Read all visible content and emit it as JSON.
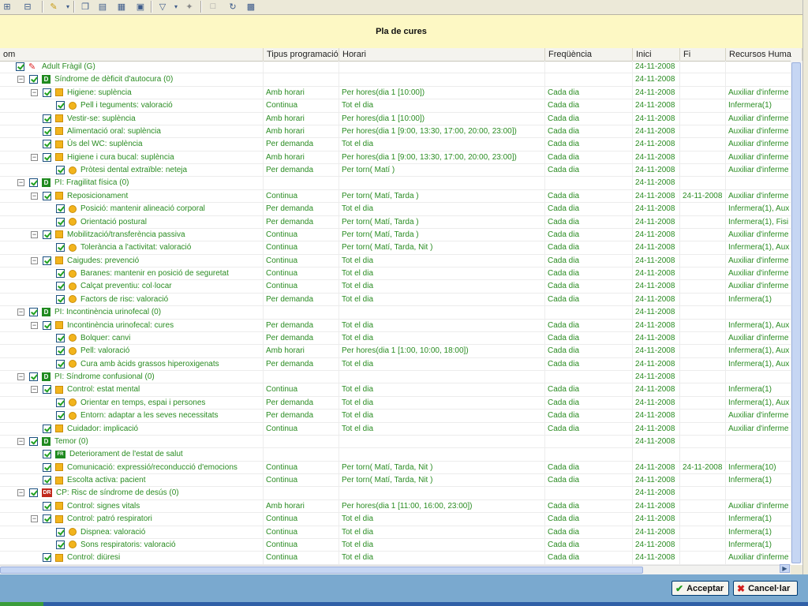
{
  "toolbar": {
    "icons": [
      "tree-expand-icon",
      "tree-collapse-icon",
      "pencil-icon",
      "copy-icon",
      "clipboard-icon",
      "book-icon",
      "monitor-icon",
      "filter-icon",
      "pin-icon",
      "document-icon",
      "refresh-icon",
      "window-icon"
    ]
  },
  "panel": {
    "title": "Pla de cures"
  },
  "columns": [
    "om",
    "Tipus programació",
    "Horari",
    "Freqüència",
    "Inici",
    "Fi",
    "Recursos Huma"
  ],
  "rows": [
    {
      "level": 0,
      "exp": false,
      "icon": "pencil",
      "name": "Adult Fràgil (G)",
      "tipus": "",
      "horari": "",
      "freq": "",
      "inici": "24-11-2008",
      "fi": "",
      "recursos": ""
    },
    {
      "level": 1,
      "exp": true,
      "icon": "D",
      "name": "Síndrome de dèficit d'autocura (0)",
      "tipus": "",
      "horari": "",
      "freq": "",
      "inici": "24-11-2008",
      "fi": "",
      "recursos": ""
    },
    {
      "level": 2,
      "exp": true,
      "icon": "sq",
      "name": "Higiene: suplència",
      "tipus": "Amb horari",
      "horari": "Per hores(dia 1 [10:00])",
      "freq": "Cada dia",
      "inici": "24-11-2008",
      "fi": "",
      "recursos": "Auxiliar d'inferme"
    },
    {
      "level": 3,
      "exp": false,
      "icon": "dot",
      "name": "Pell i teguments: valoració",
      "tipus": "Continua",
      "horari": "Tot el dia",
      "freq": "Cada dia",
      "inici": "24-11-2008",
      "fi": "",
      "recursos": "Infermera(1)"
    },
    {
      "level": 2,
      "exp": false,
      "icon": "sq",
      "name": "Vestir-se: suplència",
      "tipus": "Amb horari",
      "horari": "Per hores(dia 1 [10:00])",
      "freq": "Cada dia",
      "inici": "24-11-2008",
      "fi": "",
      "recursos": "Auxiliar d'inferme"
    },
    {
      "level": 2,
      "exp": false,
      "icon": "sq",
      "name": "Alimentació oral: suplència",
      "tipus": "Amb horari",
      "horari": "Per hores(dia 1 [9:00, 13:30, 17:00, 20:00, 23:00])",
      "freq": "Cada dia",
      "inici": "24-11-2008",
      "fi": "",
      "recursos": "Auxiliar d'inferme"
    },
    {
      "level": 2,
      "exp": false,
      "icon": "sq",
      "name": "Ús del WC: suplència",
      "tipus": "Per demanda",
      "horari": "Tot el dia",
      "freq": "Cada dia",
      "inici": "24-11-2008",
      "fi": "",
      "recursos": "Auxiliar d'inferme"
    },
    {
      "level": 2,
      "exp": true,
      "icon": "sq",
      "name": "Higiene i cura bucal: suplència",
      "tipus": "Amb horari",
      "horari": "Per hores(dia 1 [9:00, 13:30, 17:00, 20:00, 23:00])",
      "freq": "Cada dia",
      "inici": "24-11-2008",
      "fi": "",
      "recursos": "Auxiliar d'inferme"
    },
    {
      "level": 3,
      "exp": false,
      "icon": "dot",
      "name": "Pròtesi dental extraïble: neteja",
      "tipus": "Per demanda",
      "horari": "Per torn( Matí )",
      "freq": "Cada dia",
      "inici": "24-11-2008",
      "fi": "",
      "recursos": "Auxiliar d'inferme"
    },
    {
      "level": 1,
      "exp": true,
      "icon": "D",
      "name": "PI: Fragilitat física (0)",
      "tipus": "",
      "horari": "",
      "freq": "",
      "inici": "24-11-2008",
      "fi": "",
      "recursos": ""
    },
    {
      "level": 2,
      "exp": true,
      "icon": "sq",
      "name": "Reposicionament",
      "tipus": "Continua",
      "horari": "Per torn( Matí, Tarda )",
      "freq": "Cada dia",
      "inici": "24-11-2008",
      "fi": "24-11-2008",
      "recursos": "Auxiliar d'inferme"
    },
    {
      "level": 3,
      "exp": false,
      "icon": "dot",
      "name": "Posició: mantenir alineació corporal",
      "tipus": "Per demanda",
      "horari": "Tot el dia",
      "freq": "Cada dia",
      "inici": "24-11-2008",
      "fi": "",
      "recursos": "Infermera(1), Aux"
    },
    {
      "level": 3,
      "exp": false,
      "icon": "dot",
      "name": "Orientació postural",
      "tipus": "Per demanda",
      "horari": "Per torn( Matí, Tarda )",
      "freq": "Cada dia",
      "inici": "24-11-2008",
      "fi": "",
      "recursos": "Infermera(1), Fisi"
    },
    {
      "level": 2,
      "exp": true,
      "icon": "sq",
      "name": "Mobilització/transferència passiva",
      "tipus": "Continua",
      "horari": "Per torn( Matí, Tarda )",
      "freq": "Cada dia",
      "inici": "24-11-2008",
      "fi": "",
      "recursos": "Auxiliar d'inferme"
    },
    {
      "level": 3,
      "exp": false,
      "icon": "dot",
      "name": "Tolerància a l'activitat: valoració",
      "tipus": "Continua",
      "horari": "Per torn( Matí, Tarda, Nit )",
      "freq": "Cada dia",
      "inici": "24-11-2008",
      "fi": "",
      "recursos": "Infermera(1), Aux"
    },
    {
      "level": 2,
      "exp": true,
      "icon": "sq",
      "name": "Caigudes: prevenció",
      "tipus": "Continua",
      "horari": "Tot el dia",
      "freq": "Cada dia",
      "inici": "24-11-2008",
      "fi": "",
      "recursos": "Auxiliar d'inferme"
    },
    {
      "level": 3,
      "exp": false,
      "icon": "dot",
      "name": "Baranes: mantenir en posició de seguretat",
      "tipus": "Continua",
      "horari": "Tot el dia",
      "freq": "Cada dia",
      "inici": "24-11-2008",
      "fi": "",
      "recursos": "Auxiliar d'inferme"
    },
    {
      "level": 3,
      "exp": false,
      "icon": "dot",
      "name": "Calçat preventiu: col·locar",
      "tipus": "Continua",
      "horari": "Tot el dia",
      "freq": "Cada dia",
      "inici": "24-11-2008",
      "fi": "",
      "recursos": "Auxiliar d'inferme"
    },
    {
      "level": 3,
      "exp": false,
      "icon": "dot",
      "name": "Factors de risc: valoració",
      "tipus": "Per demanda",
      "horari": "Tot el dia",
      "freq": "Cada dia",
      "inici": "24-11-2008",
      "fi": "",
      "recursos": "Infermera(1)"
    },
    {
      "level": 1,
      "exp": true,
      "icon": "D",
      "name": "PI: Incontinència urinofecal (0)",
      "tipus": "",
      "horari": "",
      "freq": "",
      "inici": "24-11-2008",
      "fi": "",
      "recursos": ""
    },
    {
      "level": 2,
      "exp": true,
      "icon": "sq",
      "name": "Incontinència urinofecal: cures",
      "tipus": "Per demanda",
      "horari": "Tot el dia",
      "freq": "Cada dia",
      "inici": "24-11-2008",
      "fi": "",
      "recursos": "Infermera(1), Aux"
    },
    {
      "level": 3,
      "exp": false,
      "icon": "dot",
      "name": "Bolquer: canvi",
      "tipus": "Per demanda",
      "horari": "Tot el dia",
      "freq": "Cada dia",
      "inici": "24-11-2008",
      "fi": "",
      "recursos": "Auxiliar d'inferme"
    },
    {
      "level": 3,
      "exp": false,
      "icon": "dot",
      "name": "Pell: valoració",
      "tipus": "Amb horari",
      "horari": "Per hores(dia 1 [1:00, 10:00, 18:00])",
      "freq": "Cada dia",
      "inici": "24-11-2008",
      "fi": "",
      "recursos": "Infermera(1), Aux"
    },
    {
      "level": 3,
      "exp": false,
      "icon": "dot",
      "name": "Cura amb àcids grassos hiperoxigenats",
      "tipus": "Per demanda",
      "horari": "Tot el dia",
      "freq": "Cada dia",
      "inici": "24-11-2008",
      "fi": "",
      "recursos": "Infermera(1), Aux"
    },
    {
      "level": 1,
      "exp": true,
      "icon": "D",
      "name": "PI: Síndrome confusional (0)",
      "tipus": "",
      "horari": "",
      "freq": "",
      "inici": "24-11-2008",
      "fi": "",
      "recursos": ""
    },
    {
      "level": 2,
      "exp": true,
      "icon": "sq",
      "name": "Control: estat mental",
      "tipus": "Continua",
      "horari": "Tot el dia",
      "freq": "Cada dia",
      "inici": "24-11-2008",
      "fi": "",
      "recursos": "Infermera(1)"
    },
    {
      "level": 3,
      "exp": false,
      "icon": "dot",
      "name": "Orientar en temps, espai i persones",
      "tipus": "Per demanda",
      "horari": "Tot el dia",
      "freq": "Cada dia",
      "inici": "24-11-2008",
      "fi": "",
      "recursos": "Infermera(1), Aux"
    },
    {
      "level": 3,
      "exp": false,
      "icon": "dot",
      "name": "Entorn: adaptar a les seves necessitats",
      "tipus": "Per demanda",
      "horari": "Tot el dia",
      "freq": "Cada dia",
      "inici": "24-11-2008",
      "fi": "",
      "recursos": "Auxiliar d'inferme"
    },
    {
      "level": 2,
      "exp": false,
      "icon": "sq",
      "name": "Cuidador: implicació",
      "tipus": "Continua",
      "horari": "Tot el dia",
      "freq": "Cada dia",
      "inici": "24-11-2008",
      "fi": "",
      "recursos": "Auxiliar d'inferme"
    },
    {
      "level": 1,
      "exp": true,
      "icon": "D",
      "name": "Temor (0)",
      "tipus": "",
      "horari": "",
      "freq": "",
      "inici": "24-11-2008",
      "fi": "",
      "recursos": ""
    },
    {
      "level": 2,
      "exp": false,
      "icon": "FR",
      "name": "Deteriorament de l'estat de salut",
      "tipus": "",
      "horari": "",
      "freq": "",
      "inici": "",
      "fi": "",
      "recursos": ""
    },
    {
      "level": 2,
      "exp": false,
      "icon": "sq",
      "name": "Comunicació: expressió/reconducció d'emocions",
      "tipus": "Continua",
      "horari": "Per torn( Matí, Tarda, Nit )",
      "freq": "Cada dia",
      "inici": "24-11-2008",
      "fi": "24-11-2008",
      "recursos": "Infermera(10)"
    },
    {
      "level": 2,
      "exp": false,
      "icon": "sq",
      "name": "Escolta activa: pacient",
      "tipus": "Continua",
      "horari": "Per torn( Matí, Tarda, Nit )",
      "freq": "Cada dia",
      "inici": "24-11-2008",
      "fi": "",
      "recursos": "Infermera(1)"
    },
    {
      "level": 1,
      "exp": true,
      "icon": "DR",
      "name": "CP: Risc de síndrome de desús (0)",
      "tipus": "",
      "horari": "",
      "freq": "",
      "inici": "24-11-2008",
      "fi": "",
      "recursos": ""
    },
    {
      "level": 2,
      "exp": false,
      "icon": "sq",
      "name": "Control: signes vitals",
      "tipus": "Amb horari",
      "horari": "Per hores(dia 1 [11:00, 16:00, 23:00])",
      "freq": "Cada dia",
      "inici": "24-11-2008",
      "fi": "",
      "recursos": "Auxiliar d'inferme"
    },
    {
      "level": 2,
      "exp": true,
      "icon": "sq",
      "name": "Control: patró respiratori",
      "tipus": "Continua",
      "horari": "Tot el dia",
      "freq": "Cada dia",
      "inici": "24-11-2008",
      "fi": "",
      "recursos": "Infermera(1)"
    },
    {
      "level": 3,
      "exp": false,
      "icon": "dot",
      "name": "Dispnea: valoració",
      "tipus": "Continua",
      "horari": "Tot el dia",
      "freq": "Cada dia",
      "inici": "24-11-2008",
      "fi": "",
      "recursos": "Infermera(1)"
    },
    {
      "level": 3,
      "exp": false,
      "icon": "dot",
      "name": "Sons respiratoris: valoració",
      "tipus": "Continua",
      "horari": "Tot el dia",
      "freq": "Cada dia",
      "inici": "24-11-2008",
      "fi": "",
      "recursos": "Infermera(1)"
    },
    {
      "level": 2,
      "exp": false,
      "icon": "sq",
      "name": "Control: diüresi",
      "tipus": "Continua",
      "horari": "Tot el dia",
      "freq": "Cada dia",
      "inici": "24-11-2008",
      "fi": "",
      "recursos": "Auxiliar d'inferme"
    }
  ],
  "buttons": {
    "accept": "Acceptar",
    "cancel": "Cancel·lar"
  },
  "colors": {
    "row_text": "#2a8c22",
    "title_bg": "#fdf8c4",
    "footer_bg": "#7aa9cf"
  }
}
